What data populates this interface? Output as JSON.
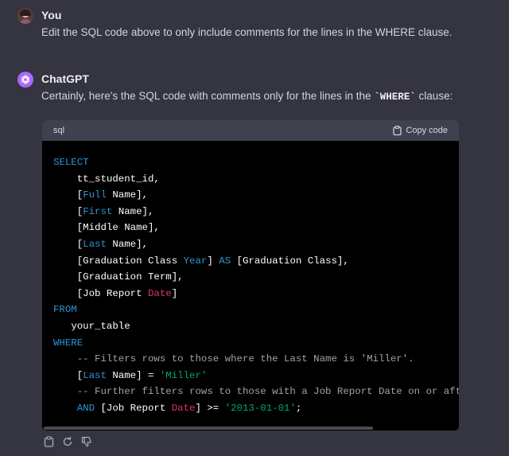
{
  "user_message": {
    "author": "You",
    "text": "Edit the SQL code above to only include comments for the lines in the WHERE clause."
  },
  "assistant_message": {
    "author": "ChatGPT",
    "intro_before": "Certainly, here's the SQL code with comments only for the lines in the ",
    "intro_code": "`WHERE`",
    "intro_after": " clause:",
    "code_block": {
      "language": "sql",
      "copy_label": "Copy code",
      "lines": [
        {
          "i": "",
          "p": [
            {
              "c": "kw",
              "t": "SELECT"
            }
          ]
        },
        {
          "i": "    ",
          "p": [
            {
              "c": "",
              "t": "tt_student_id,"
            }
          ]
        },
        {
          "i": "    ",
          "p": [
            {
              "c": "",
              "t": "["
            },
            {
              "c": "kw",
              "t": "Full"
            },
            {
              "c": "",
              "t": " Name],"
            }
          ]
        },
        {
          "i": "    ",
          "p": [
            {
              "c": "",
              "t": "["
            },
            {
              "c": "kw",
              "t": "First"
            },
            {
              "c": "",
              "t": " Name],"
            }
          ]
        },
        {
          "i": "    ",
          "p": [
            {
              "c": "",
              "t": "[Middle Name],"
            }
          ]
        },
        {
          "i": "    ",
          "p": [
            {
              "c": "",
              "t": "["
            },
            {
              "c": "kw",
              "t": "Last"
            },
            {
              "c": "",
              "t": " Name],"
            }
          ]
        },
        {
          "i": "    ",
          "p": [
            {
              "c": "",
              "t": "[Graduation Class "
            },
            {
              "c": "kw",
              "t": "Year"
            },
            {
              "c": "",
              "t": "] "
            },
            {
              "c": "kw",
              "t": "AS"
            },
            {
              "c": "",
              "t": " [Graduation Class],"
            }
          ]
        },
        {
          "i": "    ",
          "p": [
            {
              "c": "",
              "t": "[Graduation Term],"
            }
          ]
        },
        {
          "i": "    ",
          "p": [
            {
              "c": "",
              "t": "[Job Report "
            },
            {
              "c": "fn",
              "t": "Date"
            },
            {
              "c": "",
              "t": "]"
            }
          ]
        },
        {
          "i": "",
          "p": [
            {
              "c": "kw",
              "t": "FROM"
            }
          ]
        },
        {
          "i": "   ",
          "p": [
            {
              "c": "",
              "t": "your_table"
            }
          ]
        },
        {
          "i": "",
          "p": [
            {
              "c": "kw",
              "t": "WHERE"
            }
          ]
        },
        {
          "i": "    ",
          "p": [
            {
              "c": "cm",
              "t": "-- Filters rows to those where the Last Name is 'Miller'."
            }
          ]
        },
        {
          "i": "    ",
          "p": [
            {
              "c": "",
              "t": "["
            },
            {
              "c": "kw",
              "t": "Last"
            },
            {
              "c": "",
              "t": " Name] = "
            },
            {
              "c": "str",
              "t": "'Miller'"
            }
          ]
        },
        {
          "i": "    ",
          "p": [
            {
              "c": "cm",
              "t": "-- Further filters rows to those with a Job Report Date on or after"
            }
          ]
        },
        {
          "i": "    ",
          "p": [
            {
              "c": "kw",
              "t": "AND"
            },
            {
              "c": "",
              "t": " [Job Report "
            },
            {
              "c": "fn",
              "t": "Date"
            },
            {
              "c": "",
              "t": "] >= "
            },
            {
              "c": "str",
              "t": "'2013-01-01'"
            },
            {
              "c": "",
              "t": ";"
            }
          ]
        }
      ]
    }
  },
  "icons": {
    "copy": "clipboard-icon",
    "regenerate": "regenerate-icon",
    "dislike": "thumbs-down-icon"
  },
  "colors": {
    "background": "#343541",
    "code_background": "#000000",
    "code_header": "#40414f",
    "keyword": "#2e95d3",
    "string": "#00a67d",
    "builtin": "#df3079",
    "comment": "#a3a3a3",
    "gpt_avatar": "#ab68ff"
  }
}
